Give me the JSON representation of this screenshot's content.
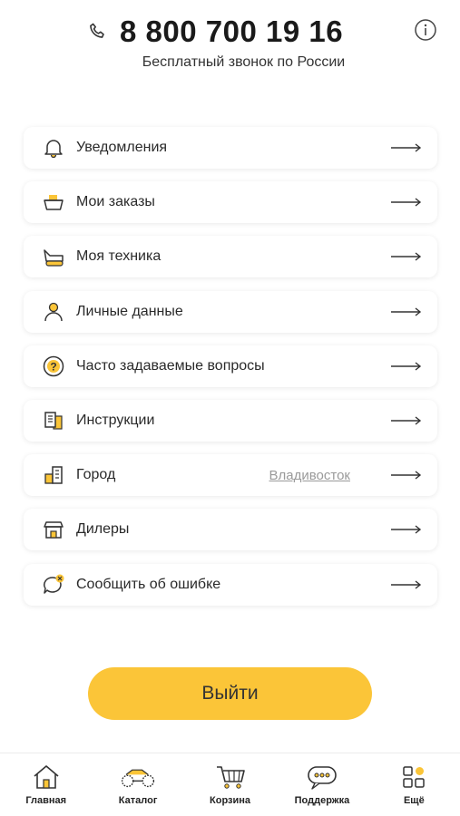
{
  "header": {
    "phone_icon": "phone-icon",
    "phone_number": "8 800 700 19 16",
    "phone_subtitle": "Бесплатный звонок по России",
    "info_icon": "info-icon"
  },
  "menu": {
    "items": [
      {
        "label": "Уведомления",
        "icon": "bell-icon"
      },
      {
        "label": "Мои заказы",
        "icon": "basket-icon"
      },
      {
        "label": "Моя техника",
        "icon": "machine-icon"
      },
      {
        "label": "Личные данные",
        "icon": "user-icon"
      },
      {
        "label": "Часто задаваемые вопросы",
        "icon": "question-icon"
      },
      {
        "label": "Инструкции",
        "icon": "document-icon"
      },
      {
        "label": "Город",
        "icon": "city-icon",
        "value": "Владивосток"
      },
      {
        "label": "Дилеры",
        "icon": "store-icon"
      },
      {
        "label": "Сообщить об ошибке",
        "icon": "error-chat-icon"
      }
    ]
  },
  "logout": {
    "label": "Выйти"
  },
  "tabbar": {
    "tabs": [
      {
        "label": "Главная",
        "icon": "home-icon"
      },
      {
        "label": "Каталог",
        "icon": "atv-icon"
      },
      {
        "label": "Корзина",
        "icon": "cart-icon"
      },
      {
        "label": "Поддержка",
        "icon": "support-icon"
      },
      {
        "label": "Ещё",
        "icon": "more-icon"
      }
    ]
  },
  "colors": {
    "accent": "#fbc538",
    "text": "#2a2a2a",
    "muted": "#9a9a9a"
  }
}
